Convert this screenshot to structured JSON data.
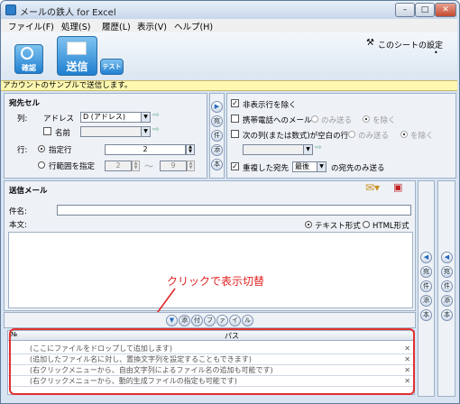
{
  "window": {
    "title": "メールの鉄人 for Excel"
  },
  "menu": [
    "ファイル(F)",
    "処理(S)",
    "履歴(L)",
    "表示(V)",
    "ヘルプ(H)"
  ],
  "toolbar": {
    "confirm": "確認",
    "send": "送信",
    "test": "テスト",
    "sheet_settings": "このシートの設定"
  },
  "status": "アカウントのサンプルで送信します。",
  "recipients": {
    "title": "宛先セル",
    "column_label": "列:",
    "address_label": "アドレス",
    "address_value": "D (アドレス)",
    "name_label": "名前",
    "name_value": "",
    "row_label": "行:",
    "specified_row_label": "指定行",
    "specified_row_value": "2",
    "row_range_label": "行範囲を指定",
    "range_from": "2",
    "range_tilde": "〜",
    "range_to": "9"
  },
  "options": {
    "exclude_hidden": "非表示行を除く",
    "mobile_mail": "携帯電話へのメール",
    "only_send": "のみ送る",
    "exclude": "を除く",
    "blank_row": "次の列(または数式)が空白の行",
    "only_send2": "のみ送る",
    "exclude2": "を除く",
    "dup_label": "重複した宛先",
    "dup_value": "最後",
    "dup_suffix": "の宛先のみ送る"
  },
  "side_buttons_1": [
    "宛",
    "件",
    "添",
    "本",
    "差"
  ],
  "mail": {
    "title": "送信メール",
    "subject_label": "件名:",
    "subject_value": "",
    "body_label": "本文:",
    "text_format": "テキスト形式",
    "html_format": "HTML形式"
  },
  "side_buttons_2": [
    "宛",
    "件",
    "添",
    "本",
    "差"
  ],
  "side_buttons_3": [
    "宛",
    "件",
    "添",
    "本",
    "差"
  ],
  "annotation": "クリックで表示切替",
  "attach_tabs": [
    "添",
    "付",
    "フ",
    "ァ",
    "イ",
    "ル"
  ],
  "files": {
    "col_no": "№",
    "col_path": "パス",
    "rows": [
      "(ここにファイルをドロップして追加します)",
      "(追加したファイル名に対し、置換文字列を設定することもできます)",
      "(右クリックメニューから、自由文字列によるファイル名の追加も可能です)",
      "(右クリックメニューから、動的生成ファイルの指定も可能です)"
    ]
  }
}
